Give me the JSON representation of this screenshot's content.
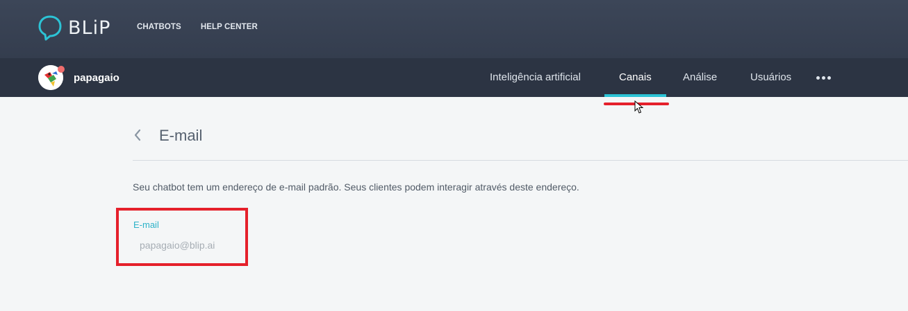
{
  "brand": {
    "logo_text": "BLiP"
  },
  "top_nav": {
    "items": [
      {
        "label": "CHATBOTS"
      },
      {
        "label": "HELP CENTER"
      }
    ]
  },
  "bot": {
    "name": "papagaio"
  },
  "tabs": [
    {
      "label": "Inteligência artificial"
    },
    {
      "label": "Canais",
      "active": true
    },
    {
      "label": "Análise"
    },
    {
      "label": "Usuários"
    }
  ],
  "page": {
    "title": "E-mail",
    "description": "Seu chatbot tem um endereço de e-mail padrão. Seus clientes podem interagir através deste endereço.",
    "email_field": {
      "label": "E-mail",
      "value": "papagaio@blip.ai"
    }
  },
  "colors": {
    "topbar": "#3a4456",
    "subbar": "#2c3443",
    "accent": "#2cc3d5",
    "annotation": "#e5202b",
    "background": "#f4f6f7"
  },
  "icons": {
    "logo": "speech-bubble-logo-icon",
    "back": "chevron-left-icon",
    "more": "more-horizontal-icon"
  }
}
